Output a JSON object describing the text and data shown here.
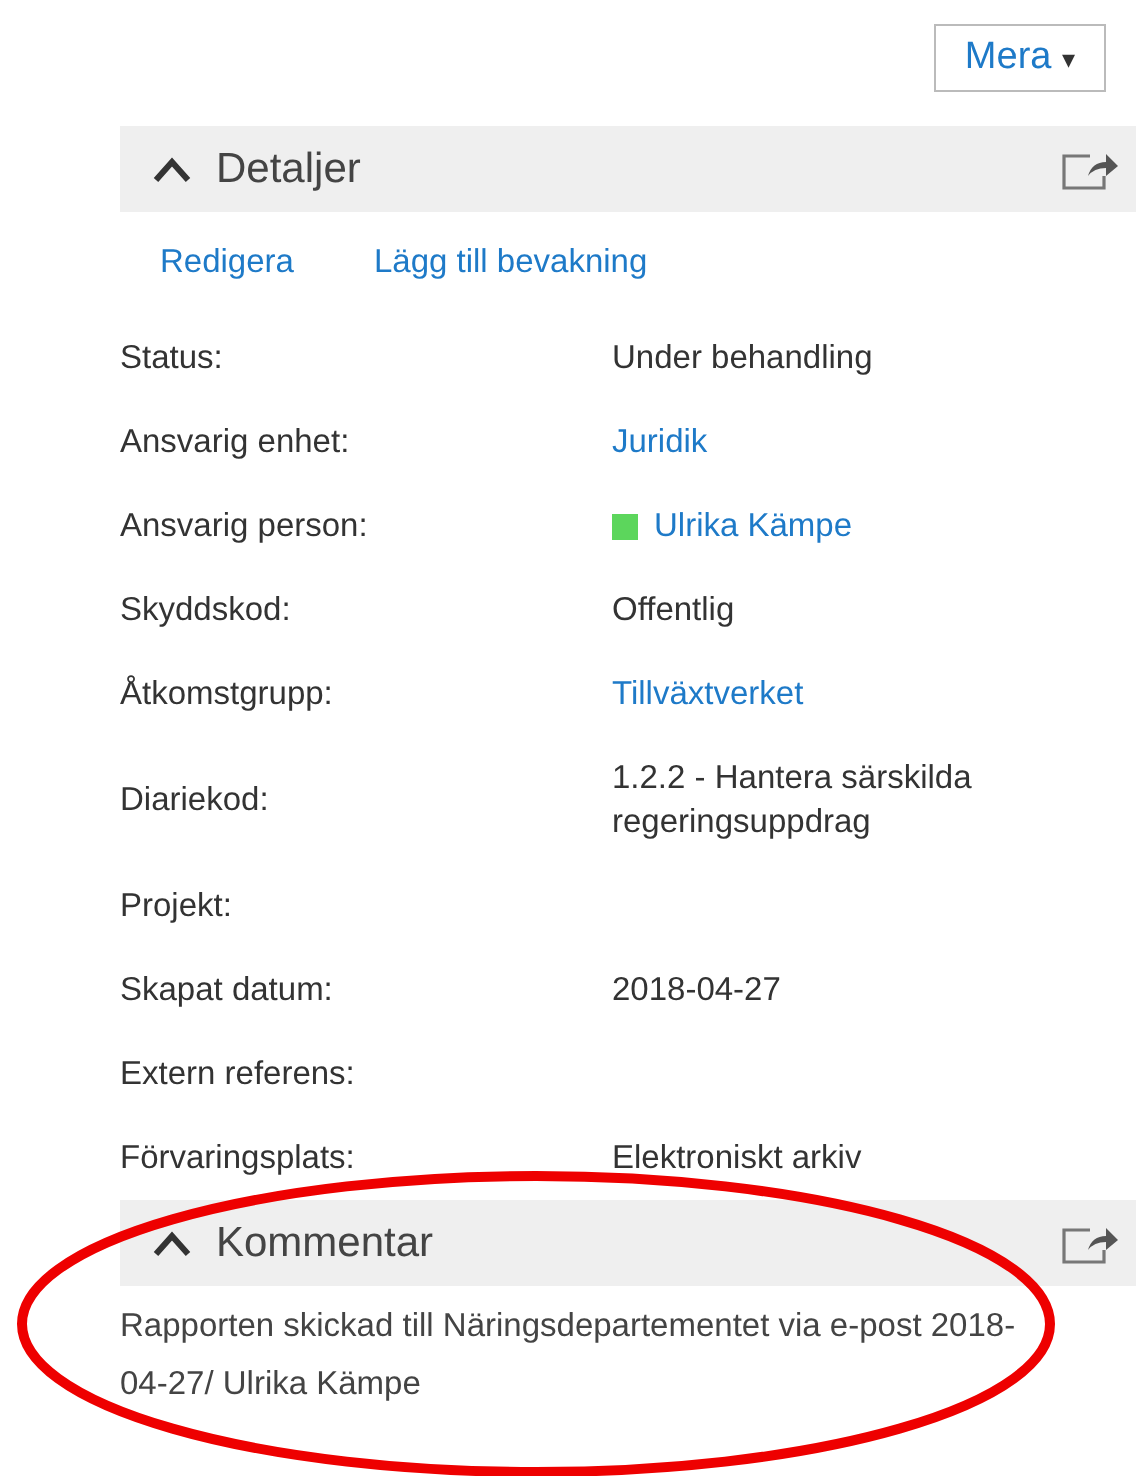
{
  "more_button": {
    "label": "Mera",
    "caret": "▾"
  },
  "details": {
    "title": "Detaljer",
    "expanded": true,
    "actions": [
      "Redigera",
      "Lägg till bevakning"
    ],
    "fields": [
      {
        "label": "Status:",
        "kind": "text",
        "value": "Under behandling"
      },
      {
        "label": "Ansvarig enhet:",
        "kind": "link",
        "value": "Juridik"
      },
      {
        "label": "Ansvarig person:",
        "kind": "person",
        "value": "Ulrika Kämpe",
        "color": "#5cd65c"
      },
      {
        "label": "Skyddskod:",
        "kind": "text",
        "value": "Offentlig"
      },
      {
        "label": "Åtkomstgrupp:",
        "kind": "link",
        "value": "Tillväxtverket"
      },
      {
        "label": "Diariekod:",
        "kind": "text",
        "value": "1.2.2 - Hantera särskilda regeringsuppdrag"
      },
      {
        "label": "Projekt:",
        "kind": "empty"
      },
      {
        "label": "Skapat datum:",
        "kind": "text",
        "value": "2018-04-27"
      },
      {
        "label": "Extern referens:",
        "kind": "empty"
      },
      {
        "label": "Förvaringsplats:",
        "kind": "text",
        "value": "Elektroniskt arkiv"
      }
    ]
  },
  "comments": {
    "title": "Kommentar",
    "expanded": true,
    "text": "Rapporten skickad till Näringsdepartementet via e-post 2018-04-27/ Ulrika Kämpe"
  },
  "annotation": {
    "kind": "ellipse",
    "color": "#ee0000"
  }
}
